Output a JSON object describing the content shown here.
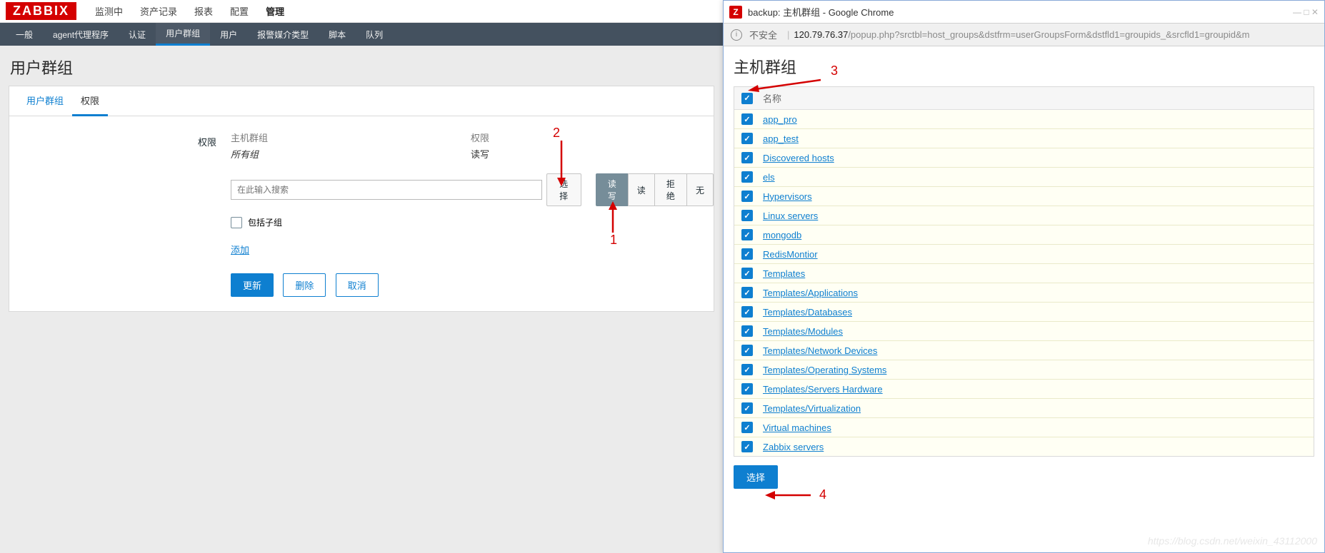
{
  "logo": "ZABBIX",
  "top_nav": [
    "监测中",
    "资产记录",
    "报表",
    "配置",
    "管理"
  ],
  "top_nav_active": 4,
  "sub_nav": [
    "一般",
    "agent代理程序",
    "认证",
    "用户群组",
    "用户",
    "报警媒介类型",
    "脚本",
    "队列"
  ],
  "sub_nav_active": 3,
  "page_title": "用户群组",
  "tabs": [
    "用户群组",
    "权限"
  ],
  "tabs_active": 1,
  "form": {
    "label": "权限",
    "col_hostgroup": "主机群组",
    "col_permission": "权限",
    "all_groups": "所有组",
    "all_groups_perm": "读写",
    "search_placeholder": "在此输入搜索",
    "select_btn": "选择",
    "rw_btn": "读写",
    "r_btn": "读",
    "deny_btn": "拒绝",
    "none_btn": "无",
    "include_sub": "包括子组",
    "add_link": "添加",
    "update_btn": "更新",
    "delete_btn": "删除",
    "cancel_btn": "取消"
  },
  "annotations": {
    "a1": "1",
    "a2": "2",
    "a3": "3",
    "a4": "4"
  },
  "chrome": {
    "title": "backup: 主机群组 - Google Chrome",
    "insecure": "不安全",
    "url_host": "120.79.76.37",
    "url_path": "/popup.php?srctbl=host_groups&dstfrm=userGroupsForm&dstfld1=groupids_&srcfld1=groupid&m",
    "popup_title": "主机群组",
    "header_label": "名称",
    "groups": [
      "app_pro",
      "app_test",
      "Discovered hosts",
      "els",
      "Hypervisors",
      "Linux servers",
      "mongodb",
      "RedisMontior",
      "Templates",
      "Templates/Applications",
      "Templates/Databases",
      "Templates/Modules",
      "Templates/Network Devices",
      "Templates/Operating Systems",
      "Templates/Servers Hardware",
      "Templates/Virtualization",
      "Virtual machines",
      "Zabbix servers"
    ],
    "select_btn": "选择"
  },
  "watermark": "https://blog.csdn.net/weixin_43112000"
}
